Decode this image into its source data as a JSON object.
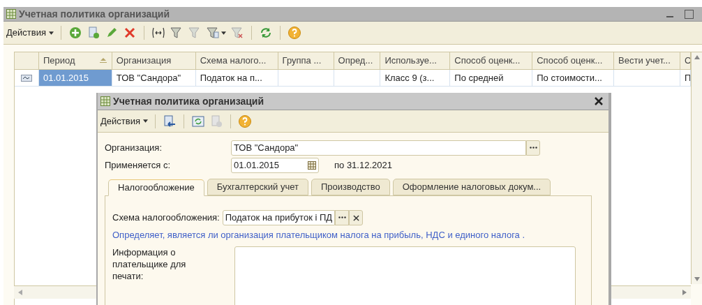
{
  "window": {
    "title": "Учетная политика организаций"
  },
  "toolbar": {
    "actions_label": "Действия"
  },
  "table": {
    "columns": [
      {
        "label": "Период",
        "sorted": true
      },
      {
        "label": "Организация",
        "sorted": false
      },
      {
        "label": "Схема налого...",
        "sorted": false
      },
      {
        "label": "Группа ...",
        "sorted": false
      },
      {
        "label": "Опред...",
        "sorted": false
      },
      {
        "label": "Используе...",
        "sorted": false
      },
      {
        "label": "Способ оценк...",
        "sorted": false
      },
      {
        "label": "Способ оценк...",
        "sorted": false
      },
      {
        "label": "Вести учет...",
        "sorted": false
      },
      {
        "label": "С",
        "sorted": false
      }
    ],
    "rows": [
      {
        "selected": true,
        "cells": [
          "01.01.2015",
          "ТОВ \"Сандора\"",
          "Податок на п...",
          "",
          "",
          "Класс 9 (з...",
          "По средней",
          "По стоимости...",
          "",
          "П"
        ]
      }
    ]
  },
  "dialog": {
    "title": "Учетная политика организаций",
    "actions_label": "Действия",
    "organization_label": "Организация:",
    "organization_value": "ТОВ \"Сандора\"",
    "applies_label": "Применяется с:",
    "applies_value": "01.01.2015",
    "applies_until": "по 31.12.2021",
    "tabs": [
      {
        "label": "Налогообложение",
        "selected": true
      },
      {
        "label": "Бухгалтерский учет",
        "selected": false
      },
      {
        "label": "Производство",
        "selected": false
      },
      {
        "label": "Оформление налоговых докум...",
        "selected": false
      }
    ],
    "tax_scheme_label": "Схема налогообложения:",
    "tax_scheme_value": "Податок на прибуток і ПД",
    "hint": "Определяет, является ли организация плательщиком налога на прибыль, НДС и единого налога .",
    "payer_info_label": "Информация о плательщике для печати:"
  }
}
